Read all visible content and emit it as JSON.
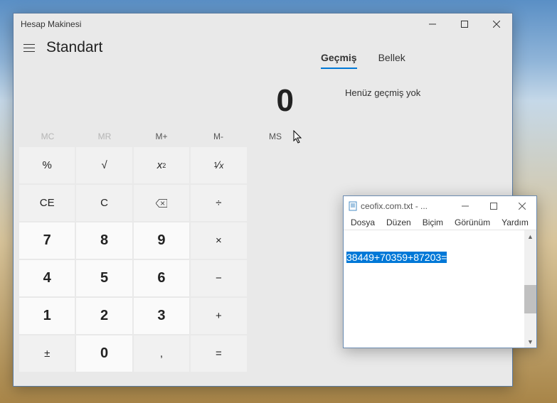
{
  "calc": {
    "window_title": "Hesap Makinesi",
    "mode": "Standart",
    "display": "0",
    "tabs": {
      "history": "Geçmiş",
      "memory": "Bellek"
    },
    "history_empty": "Henüz geçmiş yok",
    "memory_buttons": [
      "MC",
      "MR",
      "M+",
      "M-",
      "MS"
    ],
    "keys": {
      "percent": "%",
      "sqrt": "√",
      "sqr": "x²",
      "recip": "¹∕ₓ",
      "ce": "CE",
      "c": "C",
      "div": "÷",
      "mul": "×",
      "sub": "−",
      "add": "+",
      "eq": "=",
      "neg": "±",
      "dot": ",",
      "d0": "0",
      "d1": "1",
      "d2": "2",
      "d3": "3",
      "d4": "4",
      "d5": "5",
      "d6": "6",
      "d7": "7",
      "d8": "8",
      "d9": "9"
    }
  },
  "notepad": {
    "title": "ceofix.com.txt - ...",
    "menu": [
      "Dosya",
      "Düzen",
      "Biçim",
      "Görünüm",
      "Yardım"
    ],
    "content": "38449+70359+87203="
  }
}
